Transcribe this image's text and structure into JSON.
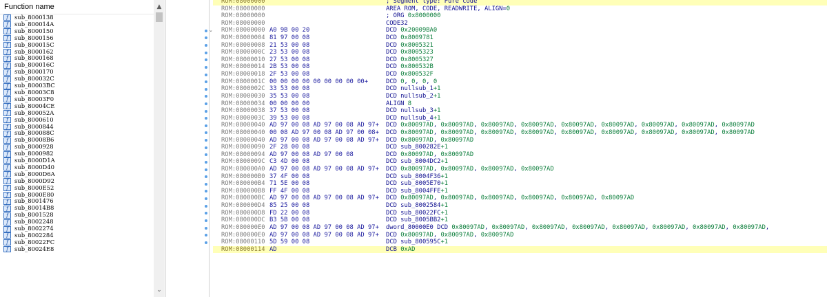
{
  "function_panel": {
    "header": "Function name",
    "icon_glyph": "f",
    "icon_name": "function-icon",
    "scroll_up_glyph": "▲",
    "scroll_down_glyph": "⌄",
    "items": [
      "sub_8000138",
      "sub_800014A",
      "sub_8000150",
      "sub_8000156",
      "sub_800015C",
      "sub_8000162",
      "sub_8000168",
      "sub_800016C",
      "sub_8000170",
      "sub_800032C",
      "sub_80003BC",
      "sub_80003C8",
      "sub_80003F0",
      "sub_80004CE",
      "sub_800052A",
      "sub_8000610",
      "sub_8000844",
      "sub_800088C",
      "sub_80008B6",
      "sub_8000928",
      "sub_8000982",
      "sub_8000D1A",
      "sub_8000D40",
      "sub_8000D6A",
      "sub_8000D92",
      "sub_8000E52",
      "sub_8000E80",
      "sub_8001476",
      "sub_80014B8",
      "sub_8001528",
      "sub_8002248",
      "sub_8002274",
      "sub_8002284",
      "sub_80022FC",
      "sub_80024E8"
    ]
  },
  "disassembly": {
    "lines": [
      {
        "addr": "ROM:08000000",
        "bytes": "",
        "instr": "; Segment type: Pure code",
        "hl": true
      },
      {
        "addr": "ROM:08000000",
        "bytes": "",
        "instr": "AREA ROM, CODE, READWRITE, ALIGN=0"
      },
      {
        "addr": "ROM:08000000",
        "bytes": "",
        "instr": "; ORG 0x8000000"
      },
      {
        "addr": "ROM:08000000",
        "bytes": "",
        "instr": "CODE32"
      },
      {
        "addr": "ROM:08000000",
        "bytes": "A0 9B 00 20",
        "instr": "DCD 0x20009BA0",
        "fold": true
      },
      {
        "addr": "ROM:08000004",
        "bytes": "81 97 00 08",
        "instr": "DCD 0x8009781"
      },
      {
        "addr": "ROM:08000008",
        "bytes": "21 53 00 08",
        "instr": "DCD 0x8005321"
      },
      {
        "addr": "ROM:0800000C",
        "bytes": "23 53 00 08",
        "instr": "DCD 0x8005323"
      },
      {
        "addr": "ROM:08000010",
        "bytes": "27 53 00 08",
        "instr": "DCD 0x8005327"
      },
      {
        "addr": "ROM:08000014",
        "bytes": "2B 53 00 08",
        "instr": "DCD 0x800532B"
      },
      {
        "addr": "ROM:08000018",
        "bytes": "2F 53 00 08",
        "instr": "DCD 0x800532F"
      },
      {
        "addr": "ROM:0800001C",
        "bytes": "00 00 00 00 00 00 00 00 00+",
        "instr": "DCD 0, 0, 0, 0"
      },
      {
        "addr": "ROM:0800002C",
        "bytes": "33 53 00 08",
        "instr": "DCD nullsub_1+1"
      },
      {
        "addr": "ROM:08000030",
        "bytes": "35 53 00 08",
        "instr": "DCD nullsub_2+1"
      },
      {
        "addr": "ROM:08000034",
        "bytes": "00 00 00 00",
        "instr": "ALIGN 8"
      },
      {
        "addr": "ROM:08000038",
        "bytes": "37 53 00 08",
        "instr": "DCD nullsub_3+1"
      },
      {
        "addr": "ROM:0800003C",
        "bytes": "39 53 00 08",
        "instr": "DCD nullsub_4+1"
      },
      {
        "addr": "ROM:08000040",
        "bytes": "AD 97 00 08 AD 97 00 08 AD 97+",
        "instr": "DCD 0x80097AD, 0x80097AD, 0x80097AD, 0x80097AD, 0x80097AD, 0x80097AD, 0x80097AD, 0x80097AD, 0x80097AD"
      },
      {
        "addr": "ROM:08000040",
        "bytes": "00 08 AD 97 00 08 AD 97 00 08+",
        "instr": "DCD 0x80097AD, 0x80097AD, 0x80097AD, 0x80097AD, 0x80097AD, 0x80097AD, 0x80097AD, 0x80097AD, 0x80097AD"
      },
      {
        "addr": "ROM:08000040",
        "bytes": "AD 97 00 08 AD 97 00 08 AD 97+",
        "instr": "DCD 0x80097AD, 0x80097AD"
      },
      {
        "addr": "ROM:08000090",
        "bytes": "2F 28 00 08",
        "instr": "DCD sub_800282E+1"
      },
      {
        "addr": "ROM:08000094",
        "bytes": "AD 97 00 08 AD 97 00 08",
        "instr": "DCD 0x80097AD, 0x80097AD"
      },
      {
        "addr": "ROM:0800009C",
        "bytes": "C3 4D 00 08",
        "instr": "DCD sub_8004DC2+1"
      },
      {
        "addr": "ROM:080000A0",
        "bytes": "AD 97 00 08 AD 97 00 08 AD 97+",
        "instr": "DCD 0x80097AD, 0x80097AD, 0x80097AD, 0x80097AD"
      },
      {
        "addr": "ROM:080000B0",
        "bytes": "37 4F 00 08",
        "instr": "DCD sub_8004F36+1"
      },
      {
        "addr": "ROM:080000B4",
        "bytes": "71 5E 00 08",
        "instr": "DCD sub_8005E70+1"
      },
      {
        "addr": "ROM:080000B8",
        "bytes": "FF 4F 00 08",
        "instr": "DCD sub_8004FFE+1"
      },
      {
        "addr": "ROM:080000BC",
        "bytes": "AD 97 00 08 AD 97 00 08 AD 97+",
        "instr": "DCD 0x80097AD, 0x80097AD, 0x80097AD, 0x80097AD, 0x80097AD, 0x80097AD"
      },
      {
        "addr": "ROM:080000D4",
        "bytes": "85 25 00 08",
        "instr": "DCD sub_8002584+1"
      },
      {
        "addr": "ROM:080000D8",
        "bytes": "FD 22 00 08",
        "instr": "DCD sub_80022FC+1"
      },
      {
        "addr": "ROM:080000DC",
        "bytes": "B3 5B 00 08",
        "instr": "DCD sub_8005BB2+1"
      },
      {
        "addr": "ROM:080000E0",
        "bytes": "AD 97 00 08 AD 97 00 08 AD 97+",
        "instr": "dword_80000E0 DCD 0x80097AD, 0x80097AD, 0x80097AD, 0x80097AD, 0x80097AD, 0x80097AD, 0x80097AD, 0x80097AD,"
      },
      {
        "addr": "ROM:080000E0",
        "bytes": "AD 97 00 08 AD 97 00 08 AD 97+",
        "instr": "DCD 0x80097AD, 0x80097AD, 0x80097AD"
      },
      {
        "addr": "ROM:08000110",
        "bytes": "5D 59 00 08",
        "instr": "DCD sub_800595C+1"
      },
      {
        "addr": "ROM:08000114",
        "bytes": "AD",
        "instr": "DCB 0xAD",
        "hl": true
      }
    ]
  },
  "colors": {
    "address": "#7a7a7a",
    "bytes": "#1a1a9e",
    "mnemonic": "#101090",
    "number": "#0a7d3a",
    "highlight_line": "#ffffb8",
    "breakpoint_dot": "#5aa0e6"
  }
}
